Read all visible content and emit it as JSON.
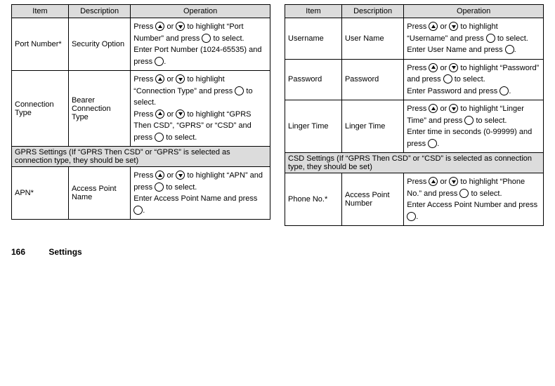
{
  "headers": {
    "item": "Item",
    "description": "Description",
    "operation": "Operation"
  },
  "left": {
    "rows": [
      {
        "item": "Port Number*",
        "desc": "Security Option",
        "op_parts": [
          "Press ",
          "[up]",
          " or ",
          "[down]",
          " to highlight “Port Number” and press ",
          "[ok]",
          " to select.",
          "[br]",
          "Enter Port Number (1024-65535) and press ",
          "[ok]",
          "."
        ]
      },
      {
        "item": "Connection Type",
        "desc": "Bearer Connection Type",
        "op_parts": [
          "Press ",
          "[up]",
          " or ",
          "[down]",
          " to highlight “Connection Type” and press ",
          "[ok]",
          " to select.",
          "[br]",
          "Press ",
          "[up]",
          " or ",
          "[down]",
          " to highlight “GPRS Then CSD”, “GPRS” or “CSD” and press ",
          "[ok]",
          " to select."
        ]
      }
    ],
    "section": "GPRS Settings (If “GPRS Then CSD” or “GPRS” is selected as connection type, they should be set)",
    "sub_rows": [
      {
        "item": "APN*",
        "desc": "Access Point Name",
        "op_parts": [
          "Press ",
          "[up]",
          " or ",
          "[down]",
          " to highlight “APN” and press ",
          "[ok]",
          " to select.",
          "[br]",
          "Enter Access Point Name and press ",
          "[ok]",
          "."
        ]
      }
    ]
  },
  "right": {
    "sub_rows_top": [
      {
        "item": "Username",
        "desc": "User Name",
        "op_parts": [
          "Press ",
          "[up]",
          " or ",
          "[down]",
          " to highlight “Username” and press ",
          "[ok]",
          " to select.",
          "[br]",
          "Enter User Name and press ",
          "[ok]",
          "."
        ]
      },
      {
        "item": "Password",
        "desc": "Password",
        "op_parts": [
          "Press ",
          "[up]",
          " or ",
          "[down]",
          " to highlight “Password” and press ",
          "[ok]",
          " to select.",
          "[br]",
          "Enter Password and press ",
          "[ok]",
          "."
        ]
      },
      {
        "item": "Linger Time",
        "desc": "Linger Time",
        "op_parts": [
          "Press ",
          "[up]",
          " or ",
          "[down]",
          " to highlight “Linger Time” and press ",
          "[ok]",
          " to select.",
          "[br]",
          "Enter time in seconds (0-99999) and press ",
          "[ok]",
          "."
        ]
      }
    ],
    "section": "CSD Settings (If “GPRS Then CSD” or “CSD” is selected as connection type, they should be set)",
    "sub_rows_bottom": [
      {
        "item": "Phone No.*",
        "desc": "Access Point Number",
        "op_parts": [
          "Press ",
          "[up]",
          " or ",
          "[down]",
          " to highlight “Phone No.” and press ",
          "[ok]",
          " to select.",
          "[br]",
          "Enter Access Point Number and press ",
          "[ok]",
          "."
        ]
      }
    ]
  },
  "footer": {
    "page": "166",
    "section": "Settings"
  }
}
